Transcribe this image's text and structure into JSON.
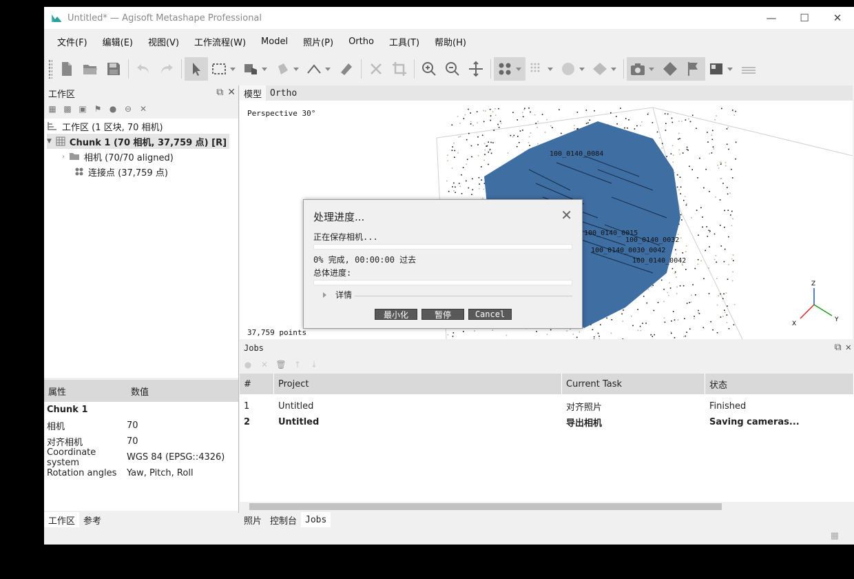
{
  "window": {
    "title": "Untitled* — Agisoft Metashape Professional",
    "controls": {
      "minimize": "—",
      "maximize": "☐",
      "close": "✕"
    }
  },
  "menu": [
    "文件(F)",
    "编辑(E)",
    "视图(V)",
    "工作流程(W)",
    "Model",
    "照片(P)",
    "Ortho",
    "工具(T)",
    "帮助(H)"
  ],
  "workspace": {
    "header": "工作区",
    "root": "工作区 (1 区块, 70 相机)",
    "chunk": "Chunk 1 (70 相机, 37,759 点) [R]",
    "cameras": "相机 (70/70 aligned)",
    "tiepoints": "连接点 (37,759 点)"
  },
  "properties": {
    "headers": [
      "属性",
      "数值"
    ],
    "title": "Chunk 1",
    "rows": [
      [
        "相机",
        "70"
      ],
      [
        "对齐相机",
        "70"
      ],
      [
        "Coordinate system",
        "WGS 84 (EPSG::4326)"
      ],
      [
        "Rotation angles",
        "Yaw, Pitch, Roll"
      ]
    ]
  },
  "left_tabs": [
    "工作区",
    "参考"
  ],
  "view_tabs": [
    "模型",
    "Ortho"
  ],
  "viewport": {
    "projection": "Perspective 30°",
    "points": "37,759 points",
    "axes": {
      "z": "Z",
      "x": "X",
      "y": "Y"
    },
    "camera_labels": [
      "100_0140_0084",
      "100_0140_0030_0042",
      "100_0140_0042",
      "100_0140_0032",
      "100_0140_0015"
    ]
  },
  "dialog": {
    "title": "处理进度...",
    "status": "正在保存相机...",
    "progress_text": "0% 完成, 00:00:00 过去",
    "progress": 0,
    "total_label": "总体进度:",
    "total_progress": 0,
    "details": "详情",
    "buttons": {
      "minimize": "最小化",
      "pause": "暂停",
      "cancel": "Cancel"
    }
  },
  "jobs": {
    "header": "Jobs",
    "columns": [
      "#",
      "Project",
      "Current Task",
      "状态"
    ],
    "rows": [
      [
        "1",
        "Untitled",
        "对齐照片",
        "Finished"
      ],
      [
        "2",
        "Untitled",
        "导出相机",
        "Saving cameras..."
      ]
    ]
  },
  "bottom_tabs": [
    "照片",
    "控制台",
    "Jobs"
  ],
  "colors": {
    "model_blue": "#3f6ea3",
    "selection": "#e5e5e5",
    "header_gray": "#d9d9d9"
  }
}
